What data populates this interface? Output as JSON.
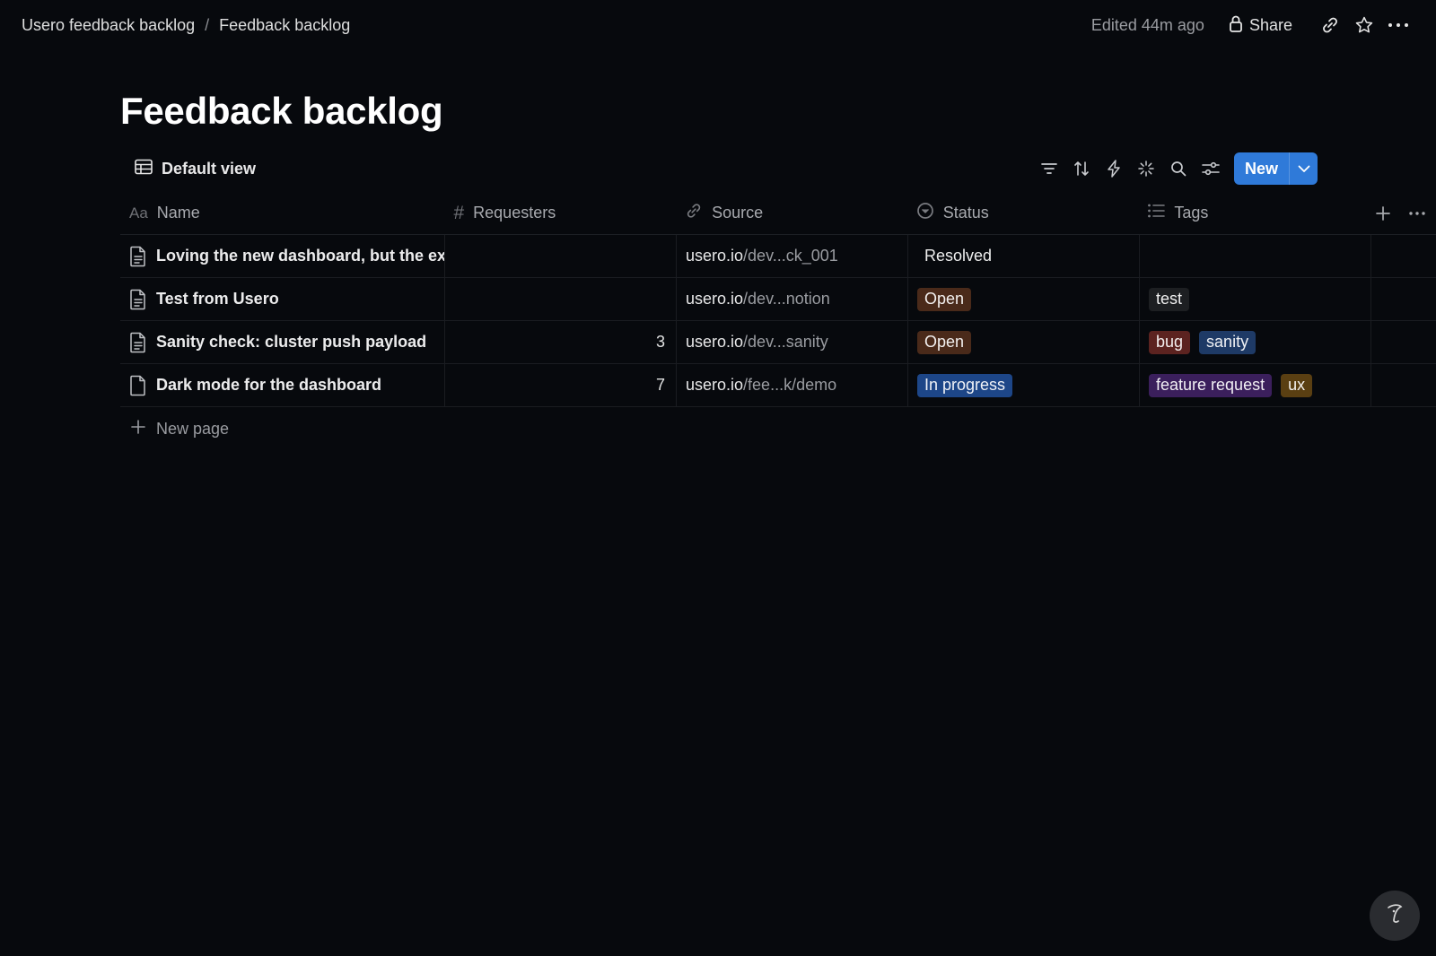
{
  "breadcrumb": {
    "workspace": "Usero feedback backlog",
    "separator": "/",
    "page": "Feedback backlog"
  },
  "topbar": {
    "edited": "Edited 44m ago",
    "share_label": "Share",
    "icons": [
      "lock-icon",
      "link-icon",
      "star-icon",
      "more-icon"
    ]
  },
  "page_title": "Feedback backlog",
  "view": {
    "label": "Default view",
    "icon": "table-icon",
    "tools": [
      "filter-icon",
      "sort-icon",
      "automation-icon",
      "ai-sparkle-icon",
      "search-icon",
      "settings-icon"
    ],
    "new_label": "New"
  },
  "columns": {
    "name": "Name",
    "requesters": "Requesters",
    "source": "Source",
    "status": "Status",
    "tags": "Tags",
    "icons": {
      "name": "Aa",
      "requesters": "#"
    }
  },
  "rows": [
    {
      "name": "Loving the new dashboard, but the ex",
      "requesters": "",
      "source_host": "usero.io",
      "source_path": "/dev...ck_001",
      "status": "Resolved",
      "status_color": "transparent",
      "tags": []
    },
    {
      "name": "Test from Usero",
      "requesters": "",
      "source_host": "usero.io",
      "source_path": "/dev...notion",
      "status": "Open",
      "status_color": "#4a2a1a",
      "tags": [
        {
          "label": "test",
          "color": "#1d1f22"
        }
      ]
    },
    {
      "name": "Sanity check: cluster push payload",
      "requesters": "3",
      "source_host": "usero.io",
      "source_path": "/dev...sanity",
      "status": "Open",
      "status_color": "#4a2a1a",
      "tags": [
        {
          "label": "bug",
          "color": "#5c2320"
        },
        {
          "label": "sanity",
          "color": "#1e3a66"
        }
      ]
    },
    {
      "name": "Dark mode for the dashboard",
      "requesters": "7",
      "source_host": "usero.io",
      "source_path": "/fee...k/demo",
      "status": "In progress",
      "status_color": "#1d4688",
      "tags": [
        {
          "label": "feature request",
          "color": "#3b1f5c"
        },
        {
          "label": "ux",
          "color": "#5a3f12"
        }
      ]
    }
  ],
  "new_page_label": "New page",
  "colors": {
    "background": "#07090d",
    "accent": "#2f7ad9"
  }
}
